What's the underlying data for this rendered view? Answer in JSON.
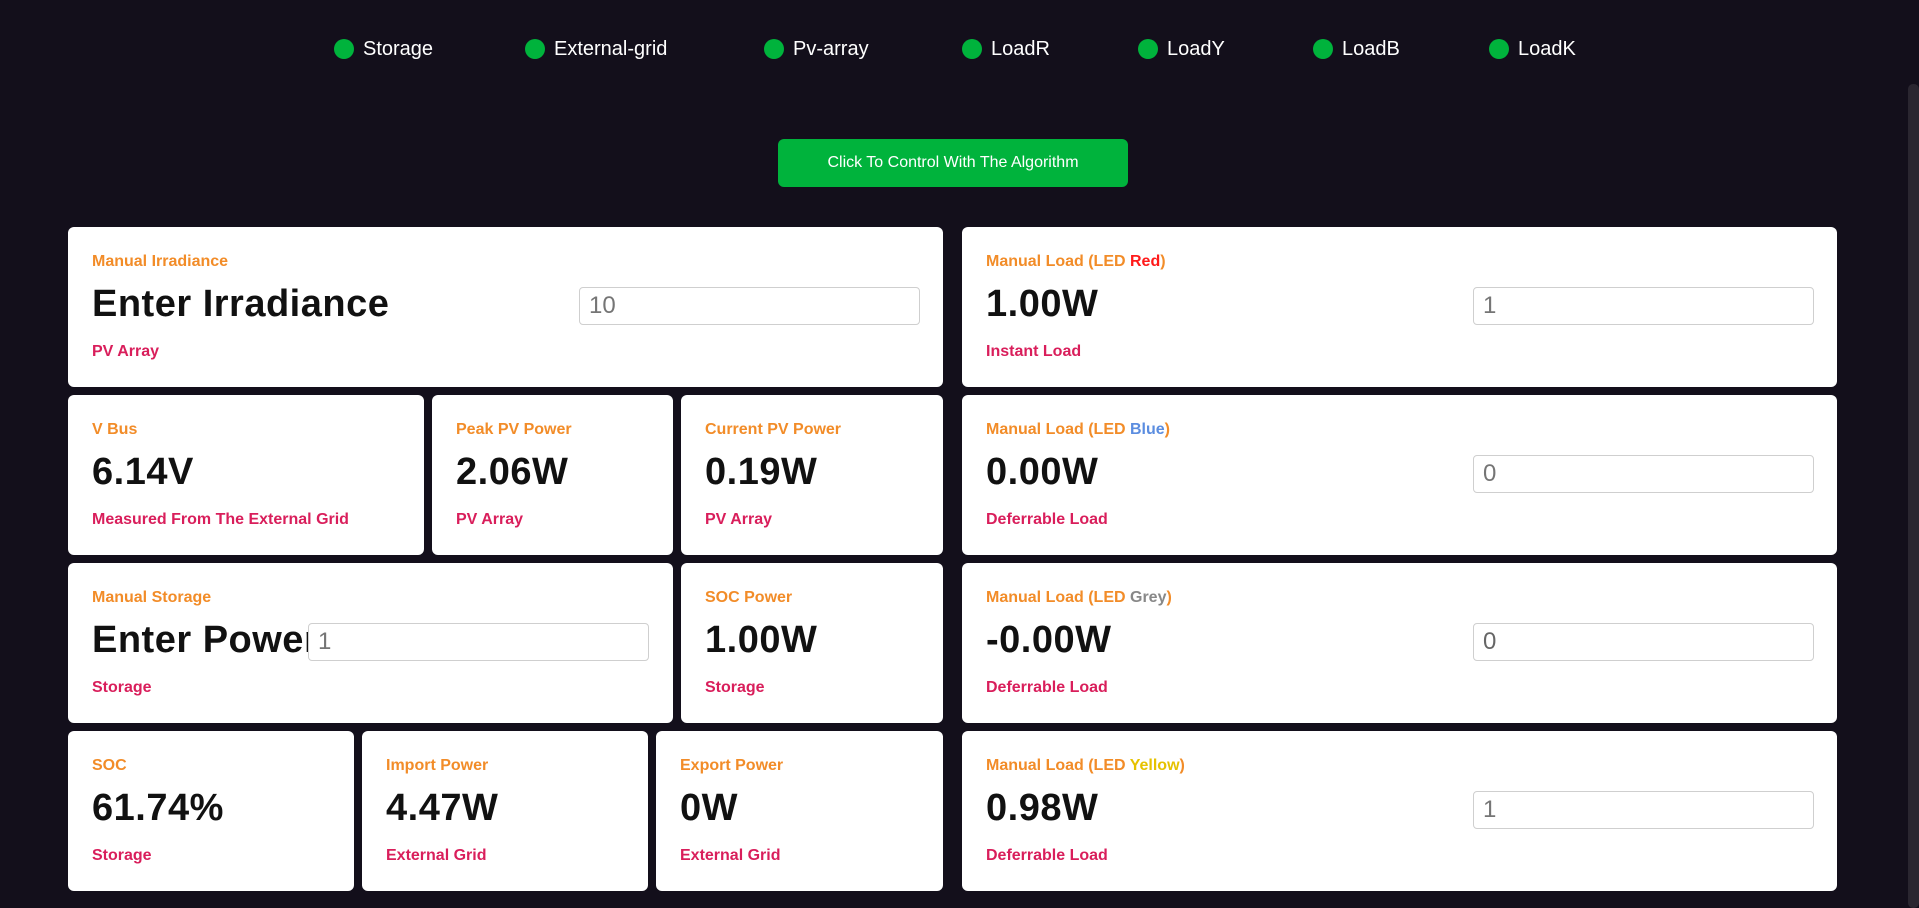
{
  "colors": {
    "background": "#130f1b",
    "status_dot": "#00b33c",
    "button_bg": "#00b33c",
    "card_title": "#f28c28",
    "card_sub": "#d91e5b",
    "led_red": "#ff1a1a",
    "led_blue": "#5b8de0",
    "led_grey": "#888888",
    "led_yellow": "#e6c200"
  },
  "status_bar": {
    "items": [
      {
        "label": "Storage",
        "icon": "status-dot-icon"
      },
      {
        "label": "External-grid",
        "icon": "status-dot-icon"
      },
      {
        "label": "Pv-array",
        "icon": "status-dot-icon"
      },
      {
        "label": "LoadR",
        "icon": "status-dot-icon"
      },
      {
        "label": "LoadY",
        "icon": "status-dot-icon"
      },
      {
        "label": "LoadB",
        "icon": "status-dot-icon"
      },
      {
        "label": "LoadK",
        "icon": "status-dot-icon"
      }
    ]
  },
  "control_button": {
    "label": "Click To Control With The Algorithm"
  },
  "cards": {
    "irradiance": {
      "title": "Manual Irradiance",
      "value": "Enter Irradiance",
      "sub": "PV Array",
      "input_placeholder": "10"
    },
    "vbus": {
      "title": "V Bus",
      "value": "6.14V",
      "sub": "Measured From The External Grid"
    },
    "peak_pv": {
      "title": "Peak PV Power",
      "value": "2.06W",
      "sub": "PV Array"
    },
    "current_pv": {
      "title": "Current PV Power",
      "value": "0.19W",
      "sub": "PV Array"
    },
    "manual_storage": {
      "title": "Manual Storage",
      "value": "Enter Power",
      "sub": "Storage",
      "input_placeholder": "1"
    },
    "soc_power": {
      "title": "SOC Power",
      "value": "1.00W",
      "sub": "Storage"
    },
    "soc": {
      "title": "SOC",
      "value": "61.74%",
      "sub": "Storage"
    },
    "import_power": {
      "title": "Import Power",
      "value": "4.47W",
      "sub": "External Grid"
    },
    "export_power": {
      "title": "Export Power",
      "value": "0W",
      "sub": "External Grid"
    },
    "load_red": {
      "title_prefix": "Manual Load (LED ",
      "title_color": "Red",
      "title_suffix": ")",
      "value": "1.00W",
      "sub": "Instant Load",
      "input_placeholder": "1"
    },
    "load_blue": {
      "title_prefix": "Manual Load (LED ",
      "title_color": "Blue",
      "title_suffix": ")",
      "value": "0.00W",
      "sub": "Deferrable Load",
      "input_placeholder": "0"
    },
    "load_grey": {
      "title_prefix": "Manual Load (LED ",
      "title_color": "Grey",
      "title_suffix": ")",
      "value": "-0.00W",
      "sub": "Deferrable Load",
      "input_value": "0"
    },
    "load_yellow": {
      "title_prefix": "Manual Load (LED ",
      "title_color": "Yellow",
      "title_suffix": ")",
      "value": "0.98W",
      "sub": "Deferrable Load",
      "input_placeholder": "1"
    }
  }
}
